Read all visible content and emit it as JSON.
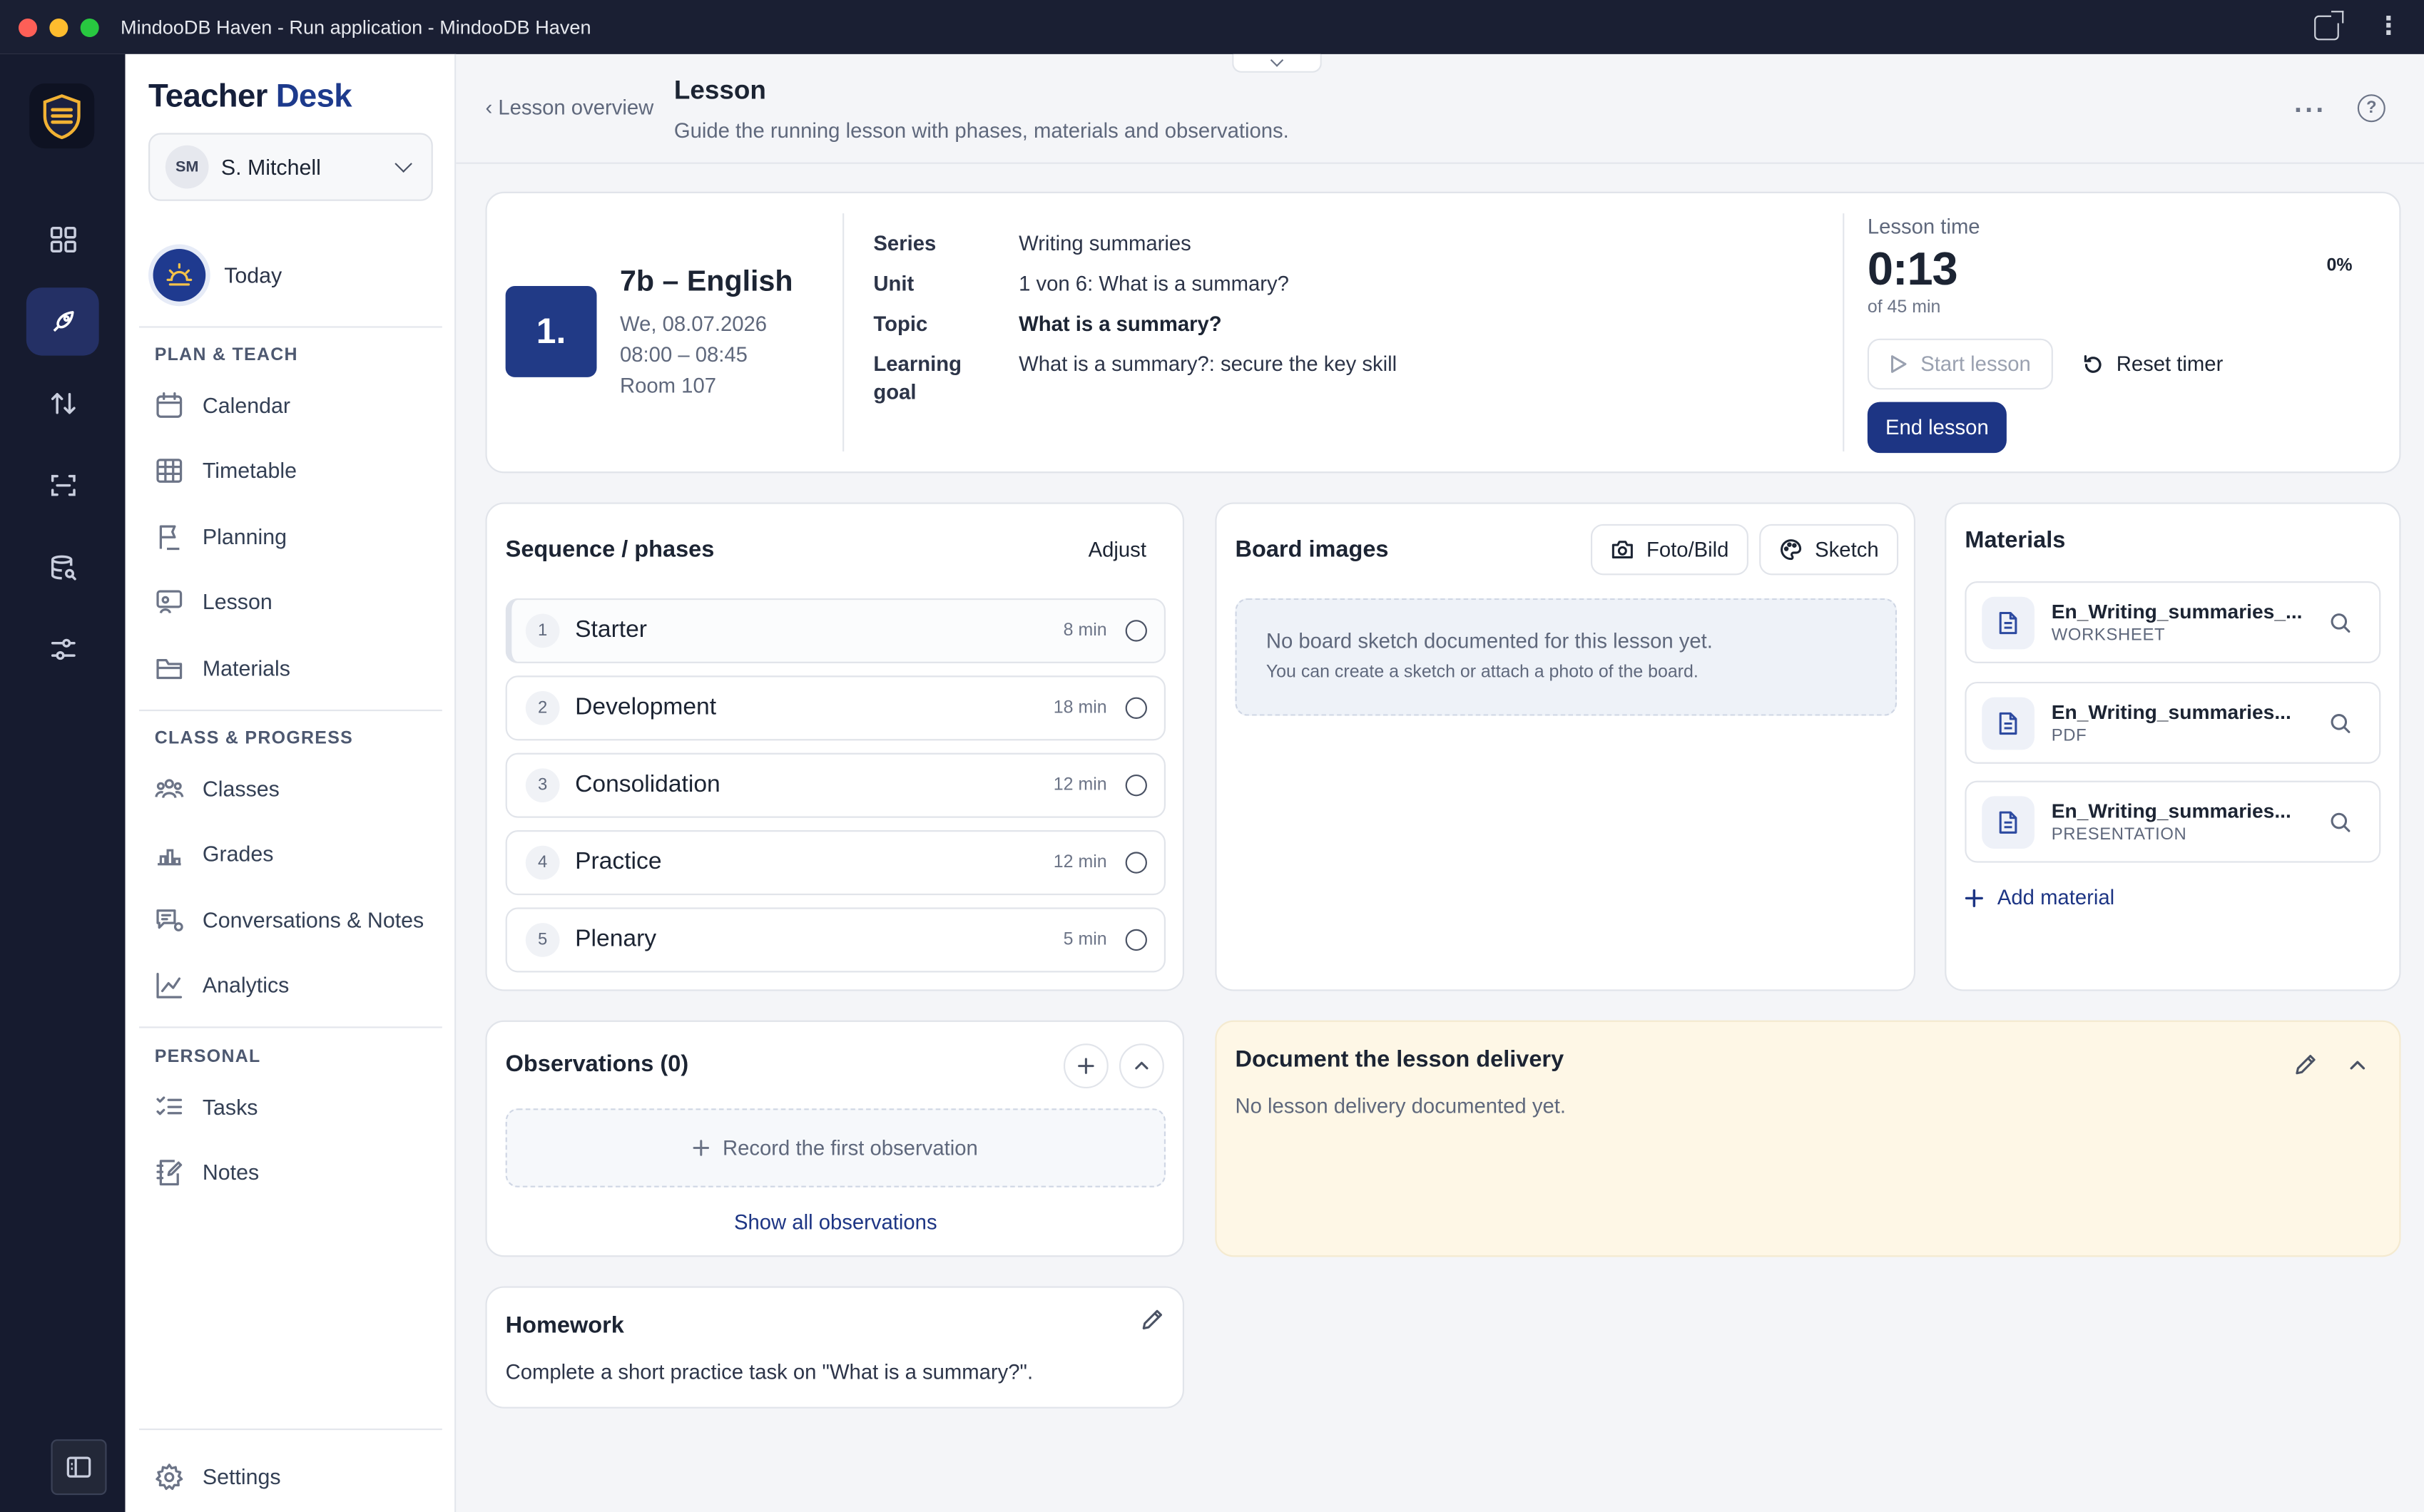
{
  "window": {
    "title": "MindooDB Haven - Run application - MindooDB Haven"
  },
  "rail": {
    "items": [
      "dashboard-icon",
      "rocket-icon",
      "transfer-icon",
      "scan-icon",
      "database-search-icon",
      "sliders-icon"
    ],
    "active": "rocket-icon"
  },
  "sidebar": {
    "brand_part1": "Teacher",
    "brand_part2": "Desk",
    "user_initials": "SM",
    "user_name": "S. Mitchell",
    "today": "Today",
    "section_plan": "PLAN & TEACH",
    "plan_items": [
      "Calendar",
      "Timetable",
      "Planning",
      "Lesson",
      "Materials"
    ],
    "section_class": "CLASS & PROGRESS",
    "class_items": [
      "Classes",
      "Grades",
      "Conversations & Notes",
      "Analytics"
    ],
    "section_personal": "PERSONAL",
    "personal_items": [
      "Tasks",
      "Notes"
    ],
    "settings": "Settings"
  },
  "header": {
    "back": "‹ Lesson overview",
    "title": "Lesson",
    "subtitle": "Guide the running lesson with phases, materials and observations."
  },
  "lesson": {
    "number": "1.",
    "class_subject": "7b – English",
    "date": "We, 08.07.2026",
    "time": "08:00 – 08:45",
    "room": "Room 107",
    "series_label": "Series",
    "series": "Writing summaries",
    "unit_label": "Unit",
    "unit": "1 von 6: What is a summary?",
    "topic_label": "Topic",
    "topic": "What is a summary?",
    "goal_label_1": "Learning",
    "goal_label_2": "goal",
    "goal": "What is a summary?: secure the key skill"
  },
  "timer": {
    "label": "Lesson time",
    "elapsed": "0:13",
    "of_total": "of 45 min",
    "percent": "0%",
    "start": "Start lesson",
    "reset": "Reset timer",
    "end": "End lesson"
  },
  "phases": {
    "title": "Sequence / phases",
    "adjust": "Adjust",
    "items": [
      {
        "num": "1",
        "name": "Starter",
        "duration": "8 min"
      },
      {
        "num": "2",
        "name": "Development",
        "duration": "18 min"
      },
      {
        "num": "3",
        "name": "Consolidation",
        "duration": "12 min"
      },
      {
        "num": "4",
        "name": "Practice",
        "duration": "12 min"
      },
      {
        "num": "5",
        "name": "Plenary",
        "duration": "5 min"
      }
    ]
  },
  "board": {
    "title": "Board images",
    "photo": "Foto/Bild",
    "sketch": "Sketch",
    "empty_1": "No board sketch documented for this lesson yet.",
    "empty_2": "You can create a sketch or attach a photo of the board."
  },
  "materials": {
    "title": "Materials",
    "items": [
      {
        "name": "En_Writing_summaries_...",
        "type": "WORKSHEET"
      },
      {
        "name": "En_Writing_summaries...",
        "type": "PDF"
      },
      {
        "name": "En_Writing_summaries...",
        "type": "PRESENTATION"
      }
    ],
    "add": "Add material"
  },
  "observations": {
    "title": "Observations (0)",
    "empty": "Record the first observation",
    "show_all": "Show all observations"
  },
  "delivery": {
    "title": "Document the lesson delivery",
    "empty": "No lesson delivery documented yet."
  },
  "homework": {
    "title": "Homework",
    "text": "Complete a short practice task on \"What is a summary?\"."
  },
  "colors": {
    "rail_bg": "#161b2f",
    "accent": "#1d3584",
    "delivery_bg": "#fef7e6"
  }
}
